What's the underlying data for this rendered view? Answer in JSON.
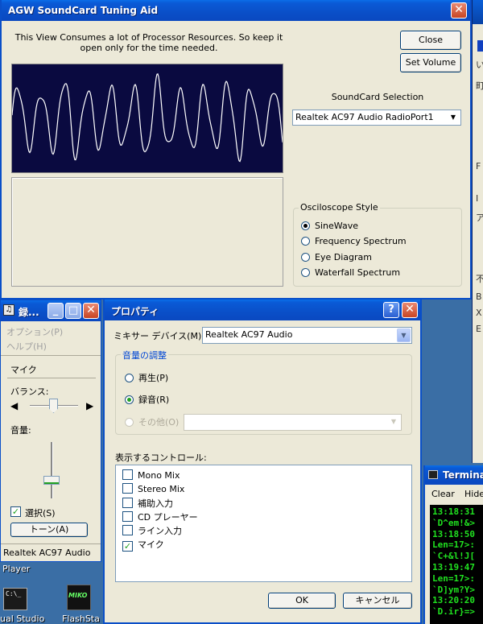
{
  "colors": {
    "desktop": "#3a6ea5",
    "scope_bg": "#0a0a40",
    "wave": "#ffffff",
    "terminal_text": "#20e020",
    "title_blue": "#0a4fc8"
  },
  "agw": {
    "title": "AGW SoundCard Tuning Aid",
    "warning": "This View Consumes a lot of Processor Resources. So keep it open only for the time needed.",
    "close_label": "Close",
    "set_volume_label": "Set Volume",
    "soundcard_heading": "SoundCard Selection",
    "soundcard_selected": "Realtek AC97 Audio RadioPort1",
    "style_group": "Osciloscope Style",
    "styles": [
      {
        "label": "SineWave",
        "checked": true
      },
      {
        "label": "Frequency Spectrum",
        "checked": false
      },
      {
        "label": "Eye Diagram",
        "checked": false
      },
      {
        "label": "Waterfall Spectrum",
        "checked": false
      }
    ]
  },
  "recorder": {
    "title": "録...",
    "menu_options": "オプション(P)",
    "menu_help": "ヘルプ(H)",
    "device_name": "マイク",
    "balance_label": "バランス:",
    "volume_label": "音量:",
    "select_label": "選択(S)",
    "tone_button": "トーン(A)",
    "status": "Realtek AC97 Audio"
  },
  "properties": {
    "title": "プロパティ",
    "mixer_label": "ミキサー デバイス(M):",
    "mixer_value": "Realtek AC97 Audio",
    "volume_group": "音量の調整",
    "radios": [
      {
        "label": "再生(P)",
        "checked": false,
        "disabled": false
      },
      {
        "label": "録音(R)",
        "checked": true,
        "disabled": false
      },
      {
        "label": "その他(O)",
        "checked": false,
        "disabled": true
      }
    ],
    "controls_label": "表示するコントロール:",
    "controls": [
      {
        "label": "Mono Mix",
        "checked": false
      },
      {
        "label": "Stereo Mix",
        "checked": false
      },
      {
        "label": "補助入力",
        "checked": false
      },
      {
        "label": "CD プレーヤー",
        "checked": false
      },
      {
        "label": "ライン入力",
        "checked": false
      },
      {
        "label": "マイク",
        "checked": true
      }
    ],
    "ok_label": "OK",
    "cancel_label": "キャンセル"
  },
  "desktop": {
    "player_label": "Player",
    "icon1_label": "ual Studio",
    "icon2_label": "FlashSta",
    "icon2_badge": "MIKO"
  },
  "terminal": {
    "title": "Termina",
    "clear_label": "Clear",
    "hide_label": "Hide",
    "lines": [
      "13:18:31",
      "`D^em!&>",
      "13:18:50",
      "Len=17>:",
      "`C+&l!J[",
      "13:19:47",
      "Len=17>:",
      "`D]ym?Y>",
      "13:20:20",
      "`D.ir}=>"
    ]
  },
  "background_window": {
    "fragments": [
      "い",
      "町",
      "F",
      "I",
      "ア",
      "不",
      "B",
      "X",
      "E"
    ]
  }
}
